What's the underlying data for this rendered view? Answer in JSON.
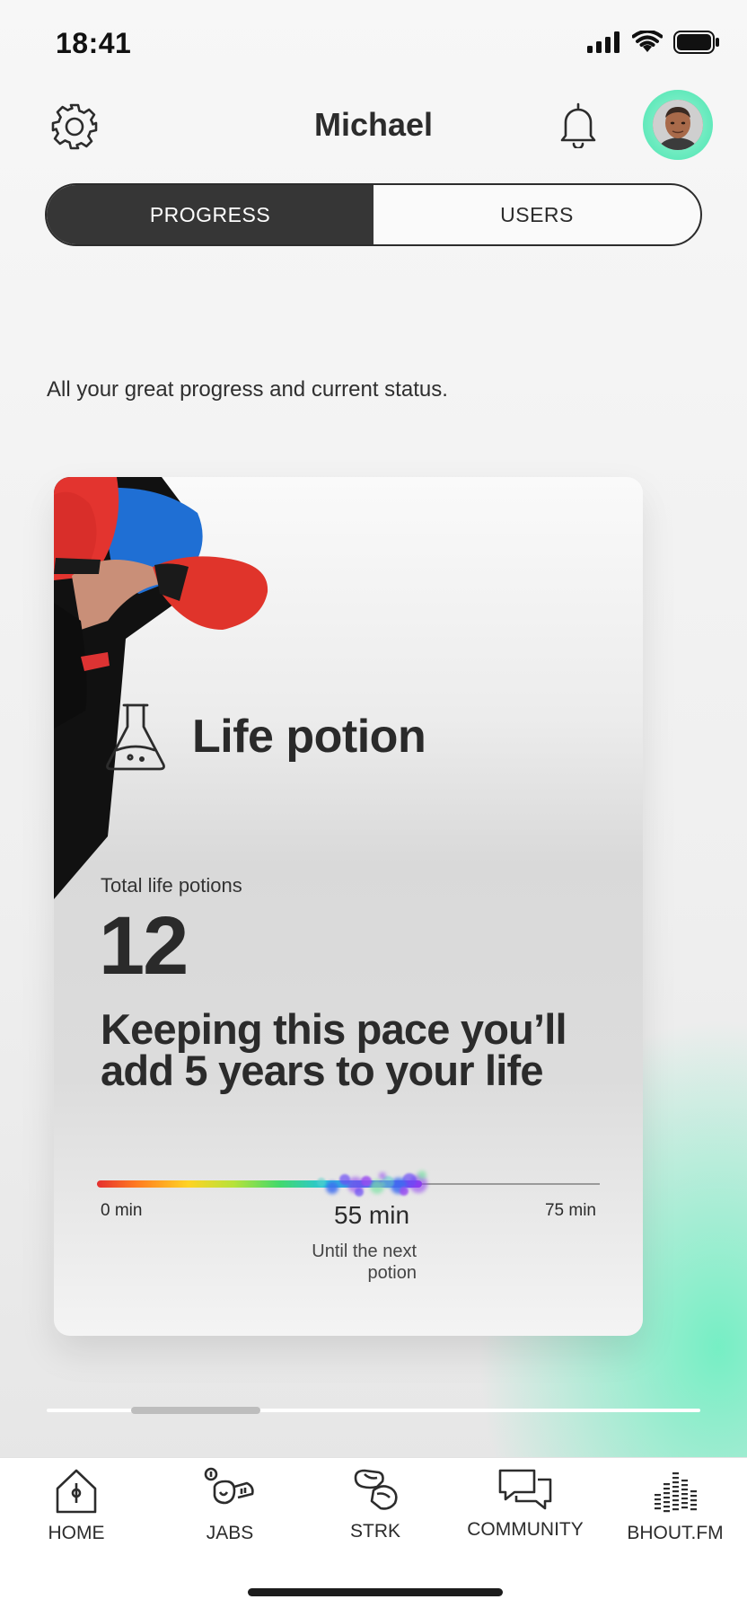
{
  "status_bar": {
    "time": "18:41",
    "icons": [
      "signal-icon",
      "wifi-icon",
      "battery-icon"
    ]
  },
  "header": {
    "title": "Michael",
    "settings_icon": "gear-icon",
    "notifications_icon": "bell-icon"
  },
  "segmented_control": {
    "tabs": [
      {
        "label": "PROGRESS",
        "active": true
      },
      {
        "label": "USERS",
        "active": false
      }
    ]
  },
  "subtitle": "All your great progress and current status.",
  "card": {
    "icon": "flask-icon",
    "title": "Life potion",
    "total_label": "Total life potions",
    "total_value": "12",
    "pace_text": "Keeping this pace you’ll add 5 years to your life",
    "progress": {
      "min_label": "0 min",
      "max_label": "75 min",
      "current_label": "55 min",
      "caption": "Until the next potion",
      "value_fraction": 0.647
    }
  },
  "pager": {
    "pages_fraction_visible": 0.2
  },
  "tab_bar": {
    "items": [
      {
        "label": "HOME",
        "icon": "home-icon"
      },
      {
        "label": "JABS",
        "icon": "jabs-icon"
      },
      {
        "label": "STRK",
        "icon": "strike-glove-icon"
      },
      {
        "label": "COMMUNITY",
        "icon": "chat-bubbles-icon"
      },
      {
        "label": "BHOUT.FM",
        "icon": "equalizer-icon"
      }
    ]
  },
  "colors": {
    "accent_mint": "#62e9bb",
    "dark": "#363636",
    "background": "#f3f3f3"
  }
}
